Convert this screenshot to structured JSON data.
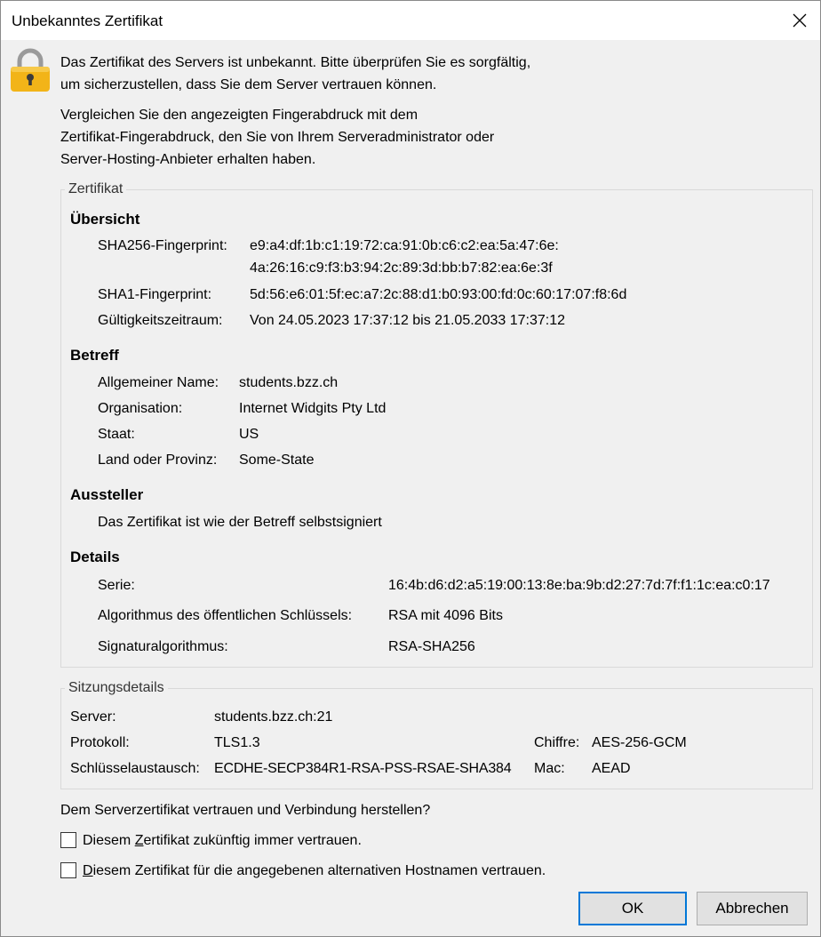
{
  "window": {
    "title": "Unbekanntes Zertifikat"
  },
  "intro": {
    "line1": "Das Zertifikat des Servers ist unbekannt. Bitte überprüfen Sie es sorgfältig,",
    "line2": "um sicherzustellen, dass Sie dem Server vertrauen können.",
    "line3": "Vergleichen Sie den angezeigten Fingerabdruck mit dem",
    "line4": "Zertifikat-Fingerabdruck, den Sie von Ihrem Serveradministrator oder",
    "line5": "Server-Hosting-Anbieter erhalten haben."
  },
  "certificate": {
    "legend": "Zertifikat",
    "overview": {
      "heading": "Übersicht",
      "sha256_label": "SHA256-Fingerprint:",
      "sha256_line1": "e9:a4:df:1b:c1:19:72:ca:91:0b:c6:c2:ea:5a:47:6e:",
      "sha256_line2": "4a:26:16:c9:f3:b3:94:2c:89:3d:bb:b7:82:ea:6e:3f",
      "sha1_label": "SHA1-Fingerprint:",
      "sha1_value": "5d:56:e6:01:5f:ec:a7:2c:88:d1:b0:93:00:fd:0c:60:17:07:f8:6d",
      "validity_label": "Gültigkeitszeitraum:",
      "validity_value": "Von 24.05.2023 17:37:12 bis 21.05.2033 17:37:12"
    },
    "subject": {
      "heading": "Betreff",
      "cn_label": "Allgemeiner Name:",
      "cn_value": "students.bzz.ch",
      "org_label": "Organisation:",
      "org_value": "Internet Widgits Pty Ltd",
      "country_label": "Staat:",
      "country_value": "US",
      "state_label": "Land oder Provinz:",
      "state_value": "Some-State"
    },
    "issuer": {
      "heading": "Aussteller",
      "text": "Das Zertifikat ist wie der Betreff selbstsigniert"
    },
    "details": {
      "heading": "Details",
      "serial_label": "Serie:",
      "serial_value": "16:4b:d6:d2:a5:19:00:13:8e:ba:9b:d2:27:7d:7f:f1:1c:ea:c0:17",
      "pubkey_label": "Algorithmus des öffentlichen Schlüssels:",
      "pubkey_value": "RSA mit 4096 Bits",
      "sig_label": "Signaturalgorithmus:",
      "sig_value": "RSA-SHA256"
    }
  },
  "session": {
    "legend": "Sitzungsdetails",
    "server_label": "Server:",
    "server_value": "students.bzz.ch:21",
    "protocol_label": "Protokoll:",
    "protocol_value": "TLS1.3",
    "cipher_label": "Chiffre:",
    "cipher_value": "AES-256-GCM",
    "kex_label": "Schlüsselaustausch:",
    "kex_value": "ECDHE-SECP384R1-RSA-PSS-RSAE-SHA384",
    "mac_label": "Mac:",
    "mac_value": "AEAD"
  },
  "question": "Dem Serverzertifikat vertrauen und Verbindung herstellen?",
  "checkbox1": {
    "prefix": "Diesem ",
    "accel": "Z",
    "suffix": "ertifikat zukünftig immer vertrauen.",
    "checked": false
  },
  "checkbox2": {
    "prefix": "",
    "accel": "D",
    "suffix": "iesem Zertifikat für die angegebenen alternativen Hostnamen vertrauen.",
    "checked": false
  },
  "buttons": {
    "ok": "OK",
    "cancel": "Abbrechen"
  },
  "colors": {
    "lock_body": "#f2b418",
    "lock_shackle": "#9a9a9a",
    "focus_border": "#0078d7"
  },
  "icons": {
    "lock": "lock-icon",
    "close": "close-icon"
  }
}
